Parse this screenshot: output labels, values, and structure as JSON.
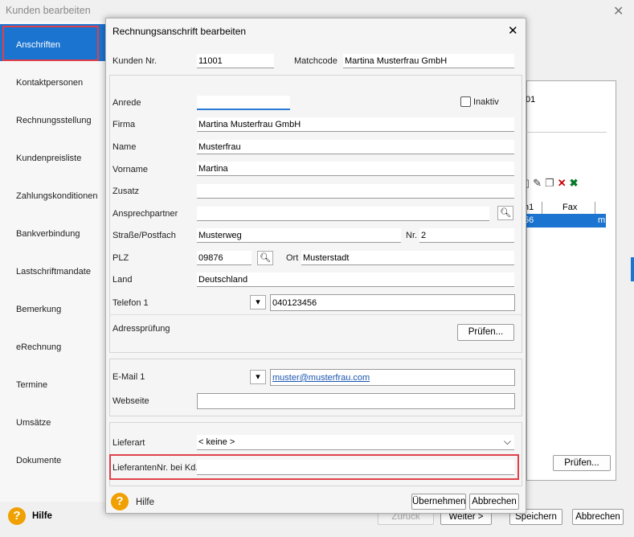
{
  "outer": {
    "title": "Kunden bearbeiten",
    "close": "✕",
    "sidebar": [
      {
        "label": "Anschriften",
        "active": true
      },
      {
        "label": "Kontaktpersonen"
      },
      {
        "label": "Rechnungsstellung"
      },
      {
        "label": "Kundenpreisliste"
      },
      {
        "label": "Zahlungskonditionen"
      },
      {
        "label": "Bankverbindung"
      },
      {
        "label": "Lastschriftmandate"
      },
      {
        "label": "Bemerkung"
      },
      {
        "label": "eRechnung"
      },
      {
        "label": "Termine"
      },
      {
        "label": "Umsätze"
      },
      {
        "label": "Dokumente"
      }
    ],
    "content_fragment": "01",
    "grid_header_1": "n1",
    "grid_header_2": "Fax",
    "grid_row_1": "56",
    "grid_row_2": "m",
    "pruefen_button": "Prüfen...",
    "help": "Hilfe",
    "zurueck": "Zurück",
    "weiter": "Weiter >",
    "speichern": "Speichern",
    "abbrechen": "Abbrechen",
    "accent": "#1b74d0"
  },
  "dialog": {
    "title": "Rechnungsanschrift bearbeiten",
    "close": "✕",
    "kunden_nr_label": "Kunden Nr.",
    "kunden_nr": "11001",
    "matchcode_label": "Matchcode",
    "matchcode": "Martina Musterfrau GmbH",
    "anrede_label": "Anrede",
    "anrede": "",
    "inaktiv_label": "Inaktiv",
    "firma_label": "Firma",
    "firma": "Martina Musterfrau GmbH",
    "name_label": "Name",
    "name": "Musterfrau",
    "vorname_label": "Vorname",
    "vorname": "Martina",
    "zusatz_label": "Zusatz",
    "zusatz": "",
    "ansprechpartner_label": "Ansprechpartner",
    "ansprechpartner": "",
    "strasse_label": "Straße/Postfach",
    "strasse": "Musterweg",
    "nr_label": "Nr.",
    "nr": "2",
    "plz_label": "PLZ",
    "plz": "09876",
    "ort_label": "Ort",
    "ort": "Musterstadt",
    "land_label": "Land",
    "land": "Deutschland",
    "telefon_label": "Telefon 1",
    "telefon": "040123456",
    "adresspruefung_label": "Adressprüfung",
    "pruefen_button": "Prüfen...",
    "email_label": "E-Mail 1",
    "email": "muster@musterfrau.com",
    "webseite_label": "Webseite",
    "webseite": "",
    "lieferart_label": "Lieferart",
    "lieferart": "< keine >",
    "lieferantennr_label": "LieferantenNr. bei Kd.",
    "lieferantennr": "",
    "help": "Hilfe",
    "uebernehmen": "Übernehmen",
    "abbrechen": "Abbrechen"
  }
}
